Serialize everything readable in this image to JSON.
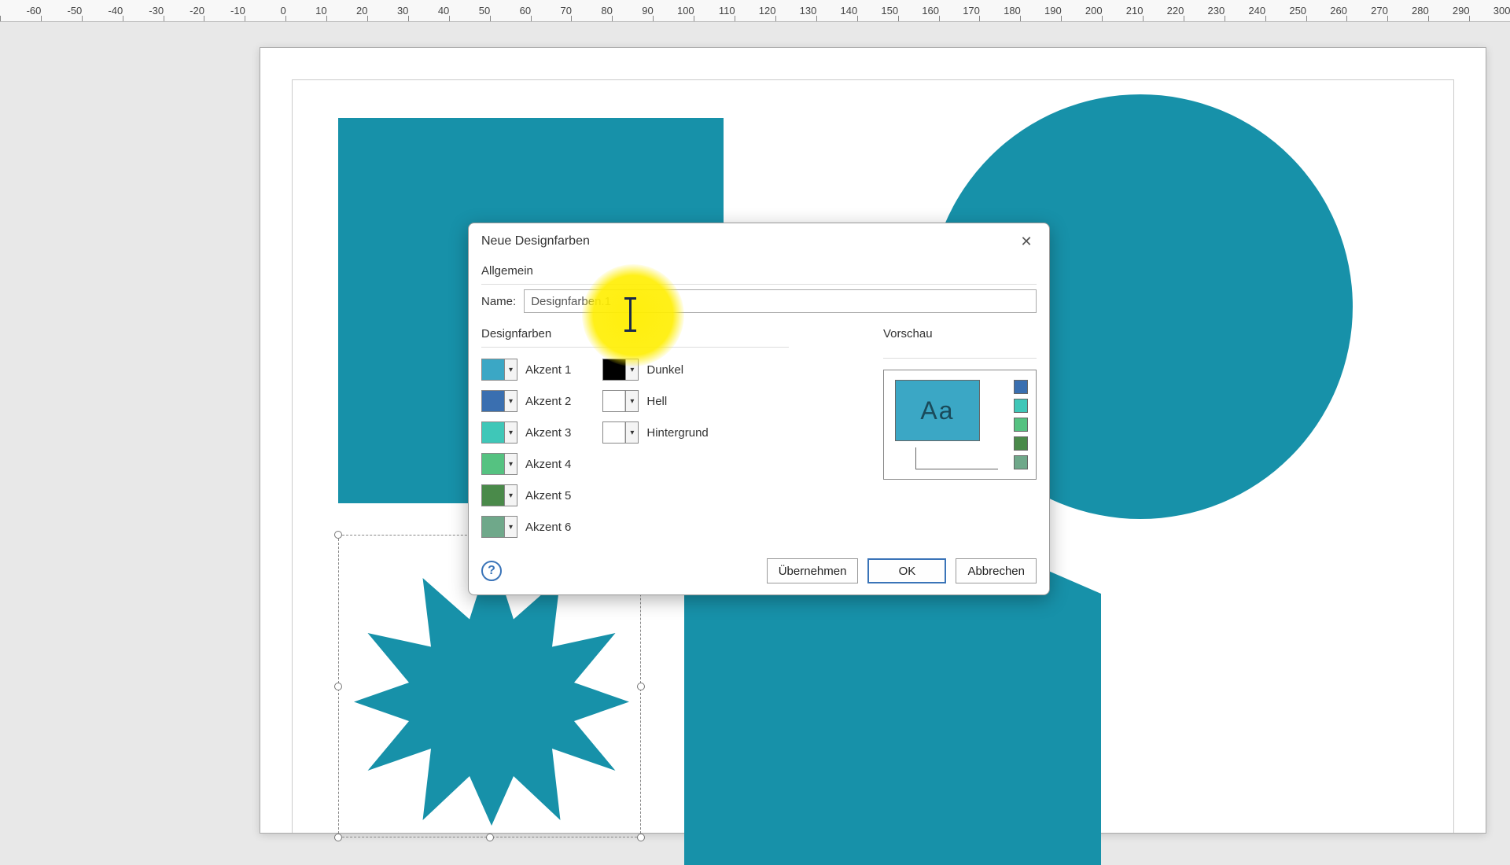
{
  "ruler": {
    "start": -70,
    "end": 300,
    "step": 10
  },
  "dialog": {
    "title": "Neue Designfarben",
    "general_label": "Allgemein",
    "name_label": "Name:",
    "name_value": "Designfarben.1",
    "design_colors_label": "Designfarben",
    "preview_label": "Vorschau",
    "accents": [
      {
        "label": "Akzent 1",
        "color": "#3ba7c5"
      },
      {
        "label": "Akzent 2",
        "color": "#3a6fb0"
      },
      {
        "label": "Akzent 3",
        "color": "#3fc7b8"
      },
      {
        "label": "Akzent 4",
        "color": "#55c281"
      },
      {
        "label": "Akzent 5",
        "color": "#4a8a4a"
      },
      {
        "label": "Akzent 6",
        "color": "#6fa88a"
      }
    ],
    "extras": [
      {
        "label": "Dunkel",
        "color": "#000000"
      },
      {
        "label": "Hell",
        "color": "#ffffff"
      },
      {
        "label": "Hintergrund",
        "color": "#ffffff"
      }
    ],
    "preview_text": "Aa",
    "preview_swatches": [
      "#3a6fb0",
      "#3fc7b8",
      "#55c281",
      "#4a8a4a",
      "#6fa88a"
    ],
    "buttons": {
      "apply": "Übernehmen",
      "ok": "OK",
      "cancel": "Abbrechen"
    }
  }
}
